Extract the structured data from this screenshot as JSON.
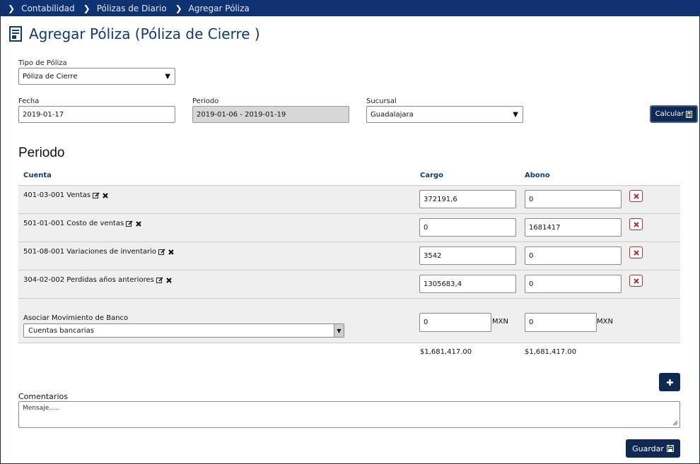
{
  "breadcrumb": [
    "Contabilidad",
    "Pólizas de Diario",
    "Agregar Póliza"
  ],
  "page_title": "Agregar Póliza (Póliza de Cierre )",
  "tipo_poliza": {
    "label": "Tipo de Póliza",
    "value": "Póliza de Cierre"
  },
  "fecha": {
    "label": "Fecha",
    "value": "2019-01-17"
  },
  "periodo": {
    "label": "Periodo",
    "value": "2019-01-06 - 2019-01-19"
  },
  "sucursal": {
    "label": "Sucursal",
    "value": "Guadalajara"
  },
  "calcular_label": "Calcular",
  "section_title": "Periodo",
  "table": {
    "headers": {
      "cuenta": "Cuenta",
      "cargo": "Cargo",
      "abono": "Abono"
    },
    "rows": [
      {
        "cuenta": "401-03-001 Ventas",
        "cargo": "372191,6",
        "abono": "0"
      },
      {
        "cuenta": "501-01-001 Costo de ventas",
        "cargo": "0",
        "abono": "1681417"
      },
      {
        "cuenta": "501-08-001 Variaciones de inventario",
        "cargo": "3542",
        "abono": "0"
      },
      {
        "cuenta": "304-02-002 Perdidas años anteriores",
        "cargo": "1305683,4",
        "abono": "0"
      }
    ]
  },
  "bank": {
    "label": "Asociar Movimiento de Banco",
    "select_value": "Cuentas bancarias",
    "cargo": "0",
    "abono": "0",
    "currency": "MXN"
  },
  "totals": {
    "cargo": "$1,681,417.00",
    "abono": "$1,681,417.00"
  },
  "comments": {
    "label": "Comentarios",
    "placeholder": "Mensaje....."
  },
  "guardar_label": "Guardar"
}
